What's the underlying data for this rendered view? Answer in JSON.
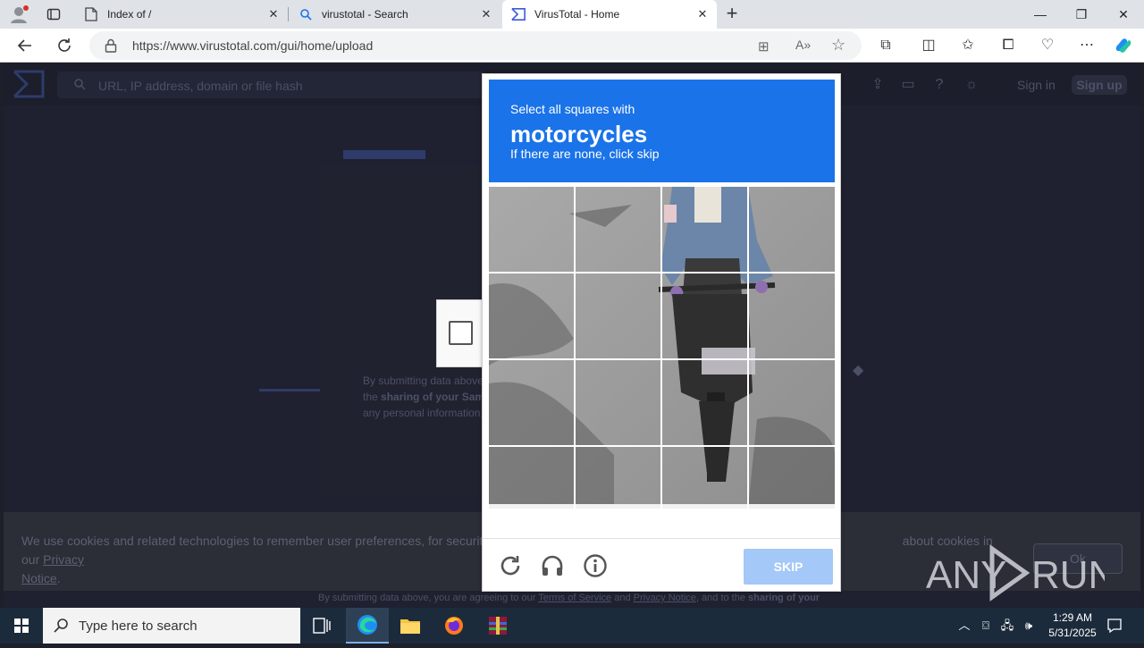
{
  "browser": {
    "tabs": [
      {
        "title": "Index of /",
        "icon": "document-icon"
      },
      {
        "title": "virustotal - Search",
        "icon": "search-icon"
      },
      {
        "title": "VirusTotal - Home",
        "icon": "virustotal-icon",
        "active": true
      }
    ],
    "url": "https://www.virustotal.com/gui/home/upload"
  },
  "virustotal": {
    "search_placeholder": "URL, IP address, domain or file hash",
    "sign_in": "Sign in",
    "sign_up": "Sign up",
    "card_text_1": "By submitting data above,",
    "card_text_2_prefix": "the ",
    "card_text_2_bold": "sharing of your Samp",
    "card_text_3": "any personal information,",
    "cookie_text": "We use cookies and related technologies to remember user preferences, for security, to",
    "cookie_text_tail": "about cookies in our",
    "cookie_link_1": "Privacy",
    "cookie_link_2": "Notice",
    "cookie_ok": "Ok",
    "footer_prefix": "By submitting data above, you are agreeing to our ",
    "footer_tos": "Terms of Service",
    "footer_and": " and ",
    "footer_privacy": "Privacy Notice",
    "footer_suffix": ", and to the ",
    "footer_bold": "sharing of your"
  },
  "captcha": {
    "line1": "Select all squares with",
    "line2": "motorcycles",
    "line3": "If there are none, click skip",
    "skip_label": "SKIP",
    "grid_rows": 4,
    "grid_cols": 4
  },
  "watermark": "ANY RUN",
  "taskbar": {
    "search_placeholder": "Type here to search",
    "time": "1:29 AM",
    "date": "5/31/2025"
  },
  "colors": {
    "captcha_header": "#1a73e8",
    "skip_button": "#a4c8f7",
    "page_bg": "#1f2130"
  }
}
